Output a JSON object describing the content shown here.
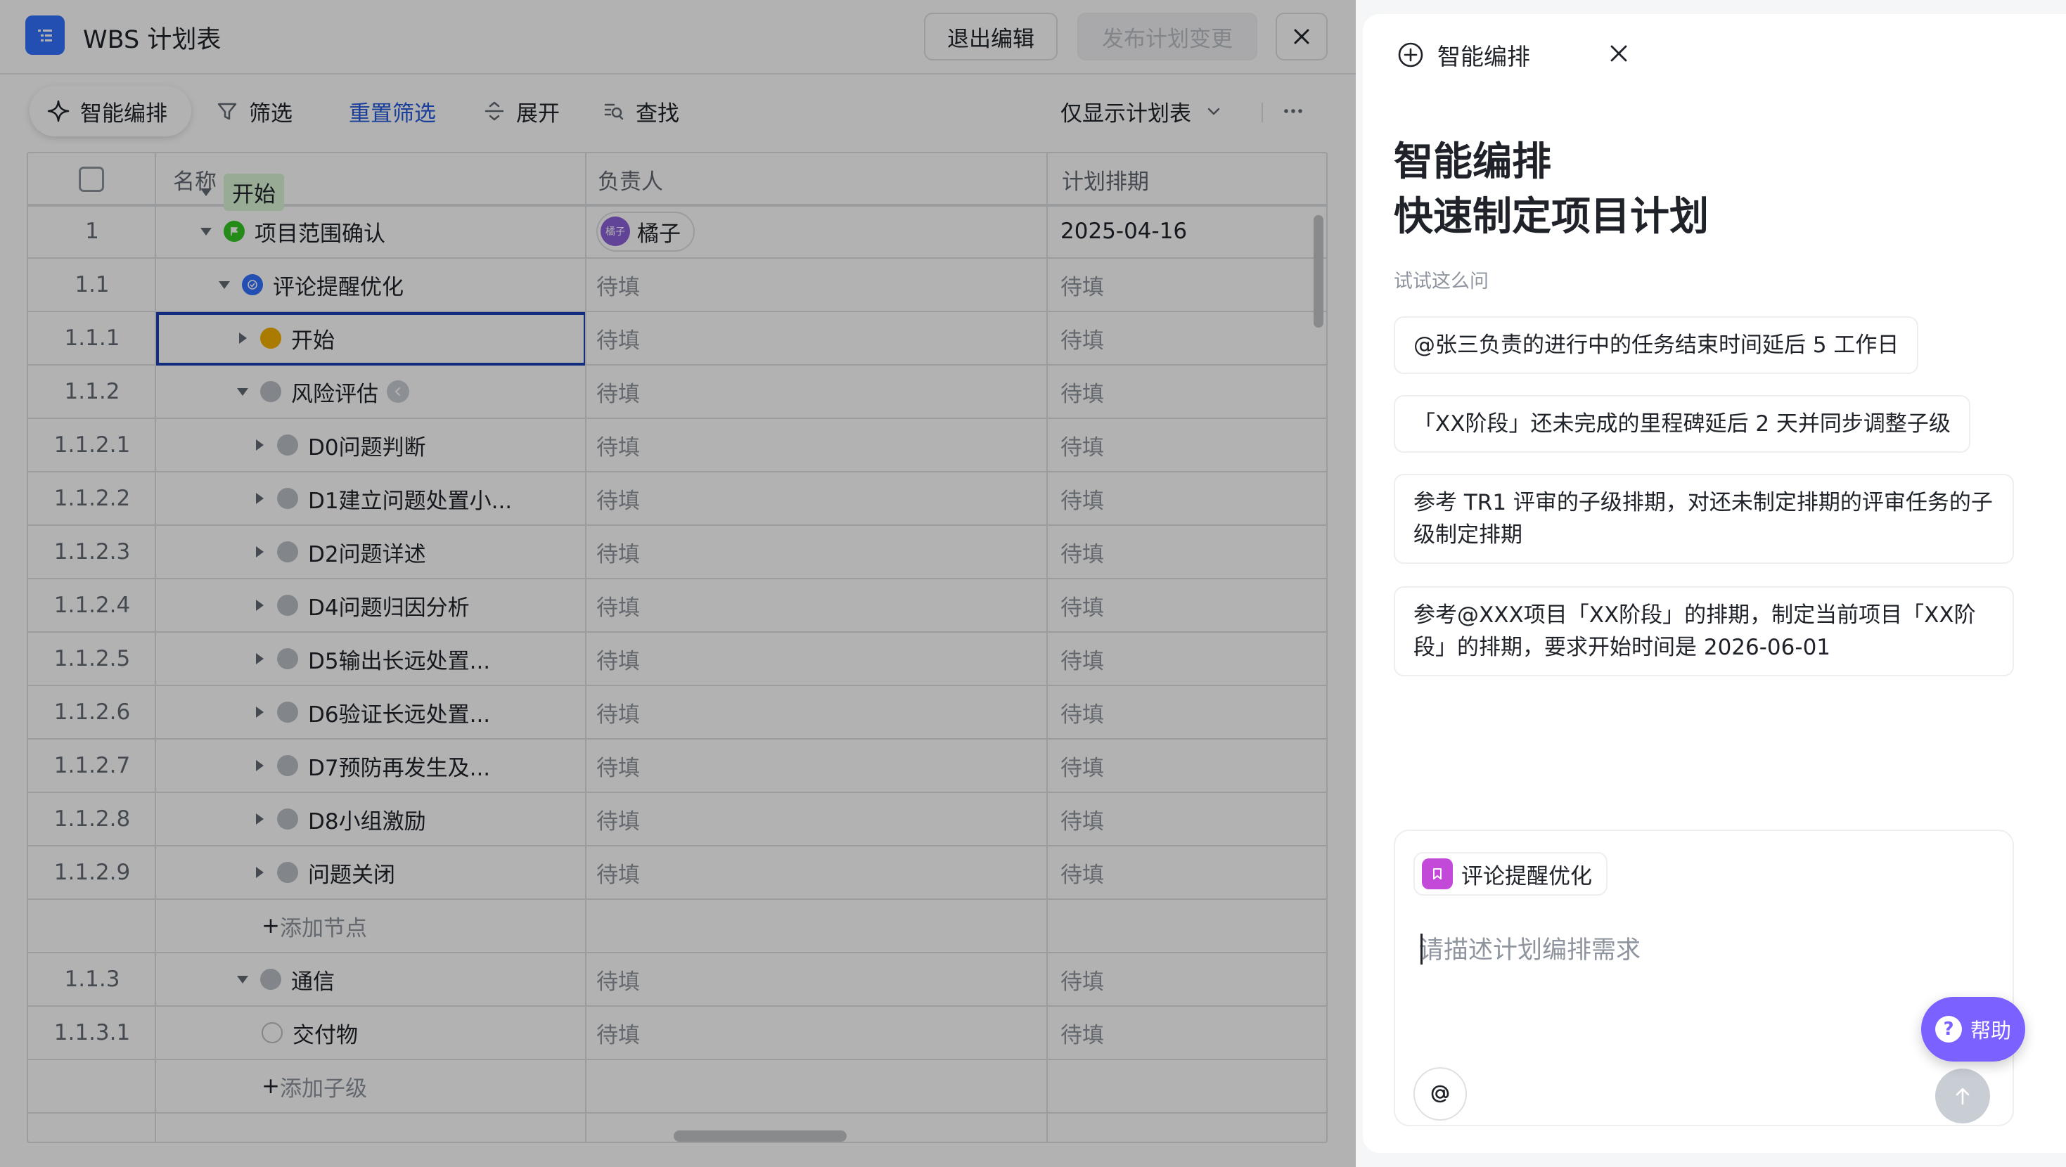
{
  "header": {
    "title": "WBS 计划表",
    "exit_edit": "退出编辑",
    "publish": "发布计划变更"
  },
  "toolbar": {
    "smart_arrange": "智能编排",
    "filter": "筛选",
    "reset_filter": "重置筛选",
    "expand": "展开",
    "find": "查找",
    "view_select": "仅显示计划表"
  },
  "table": {
    "columns": {
      "name": "名称",
      "owner": "负责人",
      "plan": "计划排期"
    },
    "rows": [
      {
        "no": "",
        "name": "开始",
        "owner": "",
        "plan": ""
      },
      {
        "no": "1",
        "name": "项目范围确认",
        "owner": "橘子",
        "avatar": "橘子",
        "plan": "2025-04-16"
      },
      {
        "no": "1.1",
        "name": "评论提醒优化",
        "owner": "待填",
        "plan": "待填"
      },
      {
        "no": "1.1.1",
        "name": "开始",
        "owner": "待填",
        "plan": "待填"
      },
      {
        "no": "1.1.2",
        "name": "风险评估",
        "owner": "待填",
        "plan": "待填"
      },
      {
        "no": "1.1.2.1",
        "name": "D0问题判断",
        "owner": "待填",
        "plan": "待填"
      },
      {
        "no": "1.1.2.2",
        "name": "D1建立问题处置小...",
        "owner": "待填",
        "plan": "待填"
      },
      {
        "no": "1.1.2.3",
        "name": "D2问题详述",
        "owner": "待填",
        "plan": "待填"
      },
      {
        "no": "1.1.2.4",
        "name": "D4问题归因分析",
        "owner": "待填",
        "plan": "待填"
      },
      {
        "no": "1.1.2.5",
        "name": "D5输出长远处置...",
        "owner": "待填",
        "plan": "待填"
      },
      {
        "no": "1.1.2.6",
        "name": "D6验证长远处置...",
        "owner": "待填",
        "plan": "待填"
      },
      {
        "no": "1.1.2.7",
        "name": "D7预防再发生及...",
        "owner": "待填",
        "plan": "待填"
      },
      {
        "no": "1.1.2.8",
        "name": "D8小组激励",
        "owner": "待填",
        "plan": "待填"
      },
      {
        "no": "1.1.2.9",
        "name": "问题关闭",
        "owner": "待填",
        "plan": "待填"
      },
      {
        "no": "",
        "name": "添加节点",
        "owner": "",
        "plan": ""
      },
      {
        "no": "1.1.3",
        "name": "通信",
        "owner": "待填",
        "plan": "待填"
      },
      {
        "no": "1.1.3.1",
        "name": "交付物",
        "owner": "待填",
        "plan": "待填"
      },
      {
        "no": "",
        "name": "添加子级",
        "owner": "",
        "plan": ""
      }
    ]
  },
  "panel": {
    "header_title": "智能编排",
    "title_line1": "智能编排",
    "title_line2": "快速制定项目计划",
    "hint": "试试这么问",
    "suggestions": [
      "@张三负责的进行中的任务结束时间延后 5 工作日",
      "「XX阶段」还未完成的里程碑延后 2 天并同步调整子级",
      "参考 TR1 评审的子级排期，对还未制定排期的评审任务的子级制定排期",
      "参考@XXX项目「XX阶段」的排期，制定当前项目「XX阶段」的排期，要求开始时间是 2026-06-01"
    ],
    "context_chip": "评论提醒优化",
    "input_placeholder": "请描述计划编排需求"
  },
  "help": {
    "label": "帮助"
  },
  "colors": {
    "accent": "#3370ff",
    "link": "#245bdb",
    "help": "#7b61ff",
    "context_icon": "#c34ad9"
  }
}
